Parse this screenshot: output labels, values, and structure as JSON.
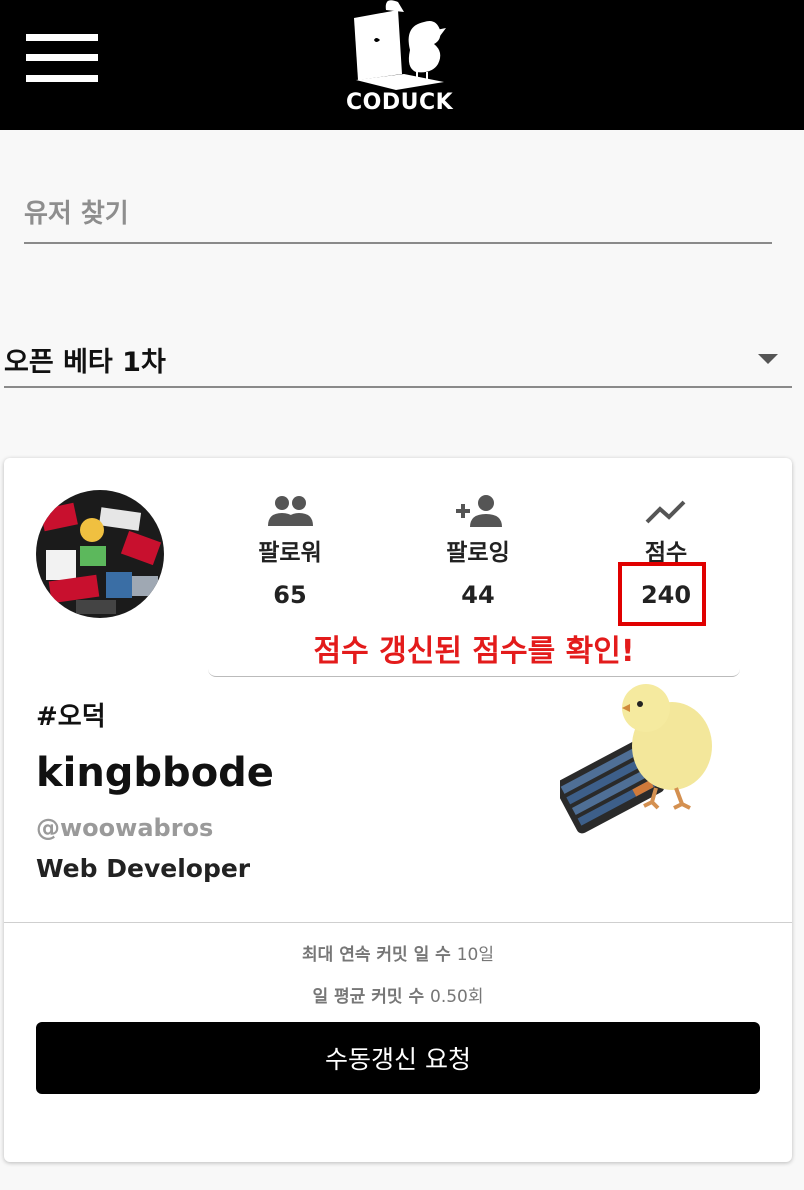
{
  "header": {
    "brand": "CODUCK"
  },
  "search": {
    "placeholder": "유저 찾기"
  },
  "season_select": {
    "value": "오픈 베타 1차"
  },
  "profile": {
    "stats": {
      "followers_label": "팔로워",
      "followers_value": "65",
      "following_label": "팔로잉",
      "following_value": "44",
      "score_label": "점수",
      "score_value": "240"
    },
    "annotation": "점수 갱신된 점수를 확인!",
    "tag": "#오덕",
    "username": "kingbbode",
    "handle": "@woowabros",
    "role": "Web Developer",
    "max_streak_label": "최대 연속 커밋 일 수",
    "max_streak_value": "10일",
    "avg_commits_label": "일 평균 커밋 수",
    "avg_commits_value": "0.50회",
    "refresh_button": "수동갱신 요청"
  },
  "colors": {
    "header_bg": "#000000",
    "highlight": "#e00000",
    "annotation": "#e31b1b",
    "button_bg": "#000000"
  }
}
